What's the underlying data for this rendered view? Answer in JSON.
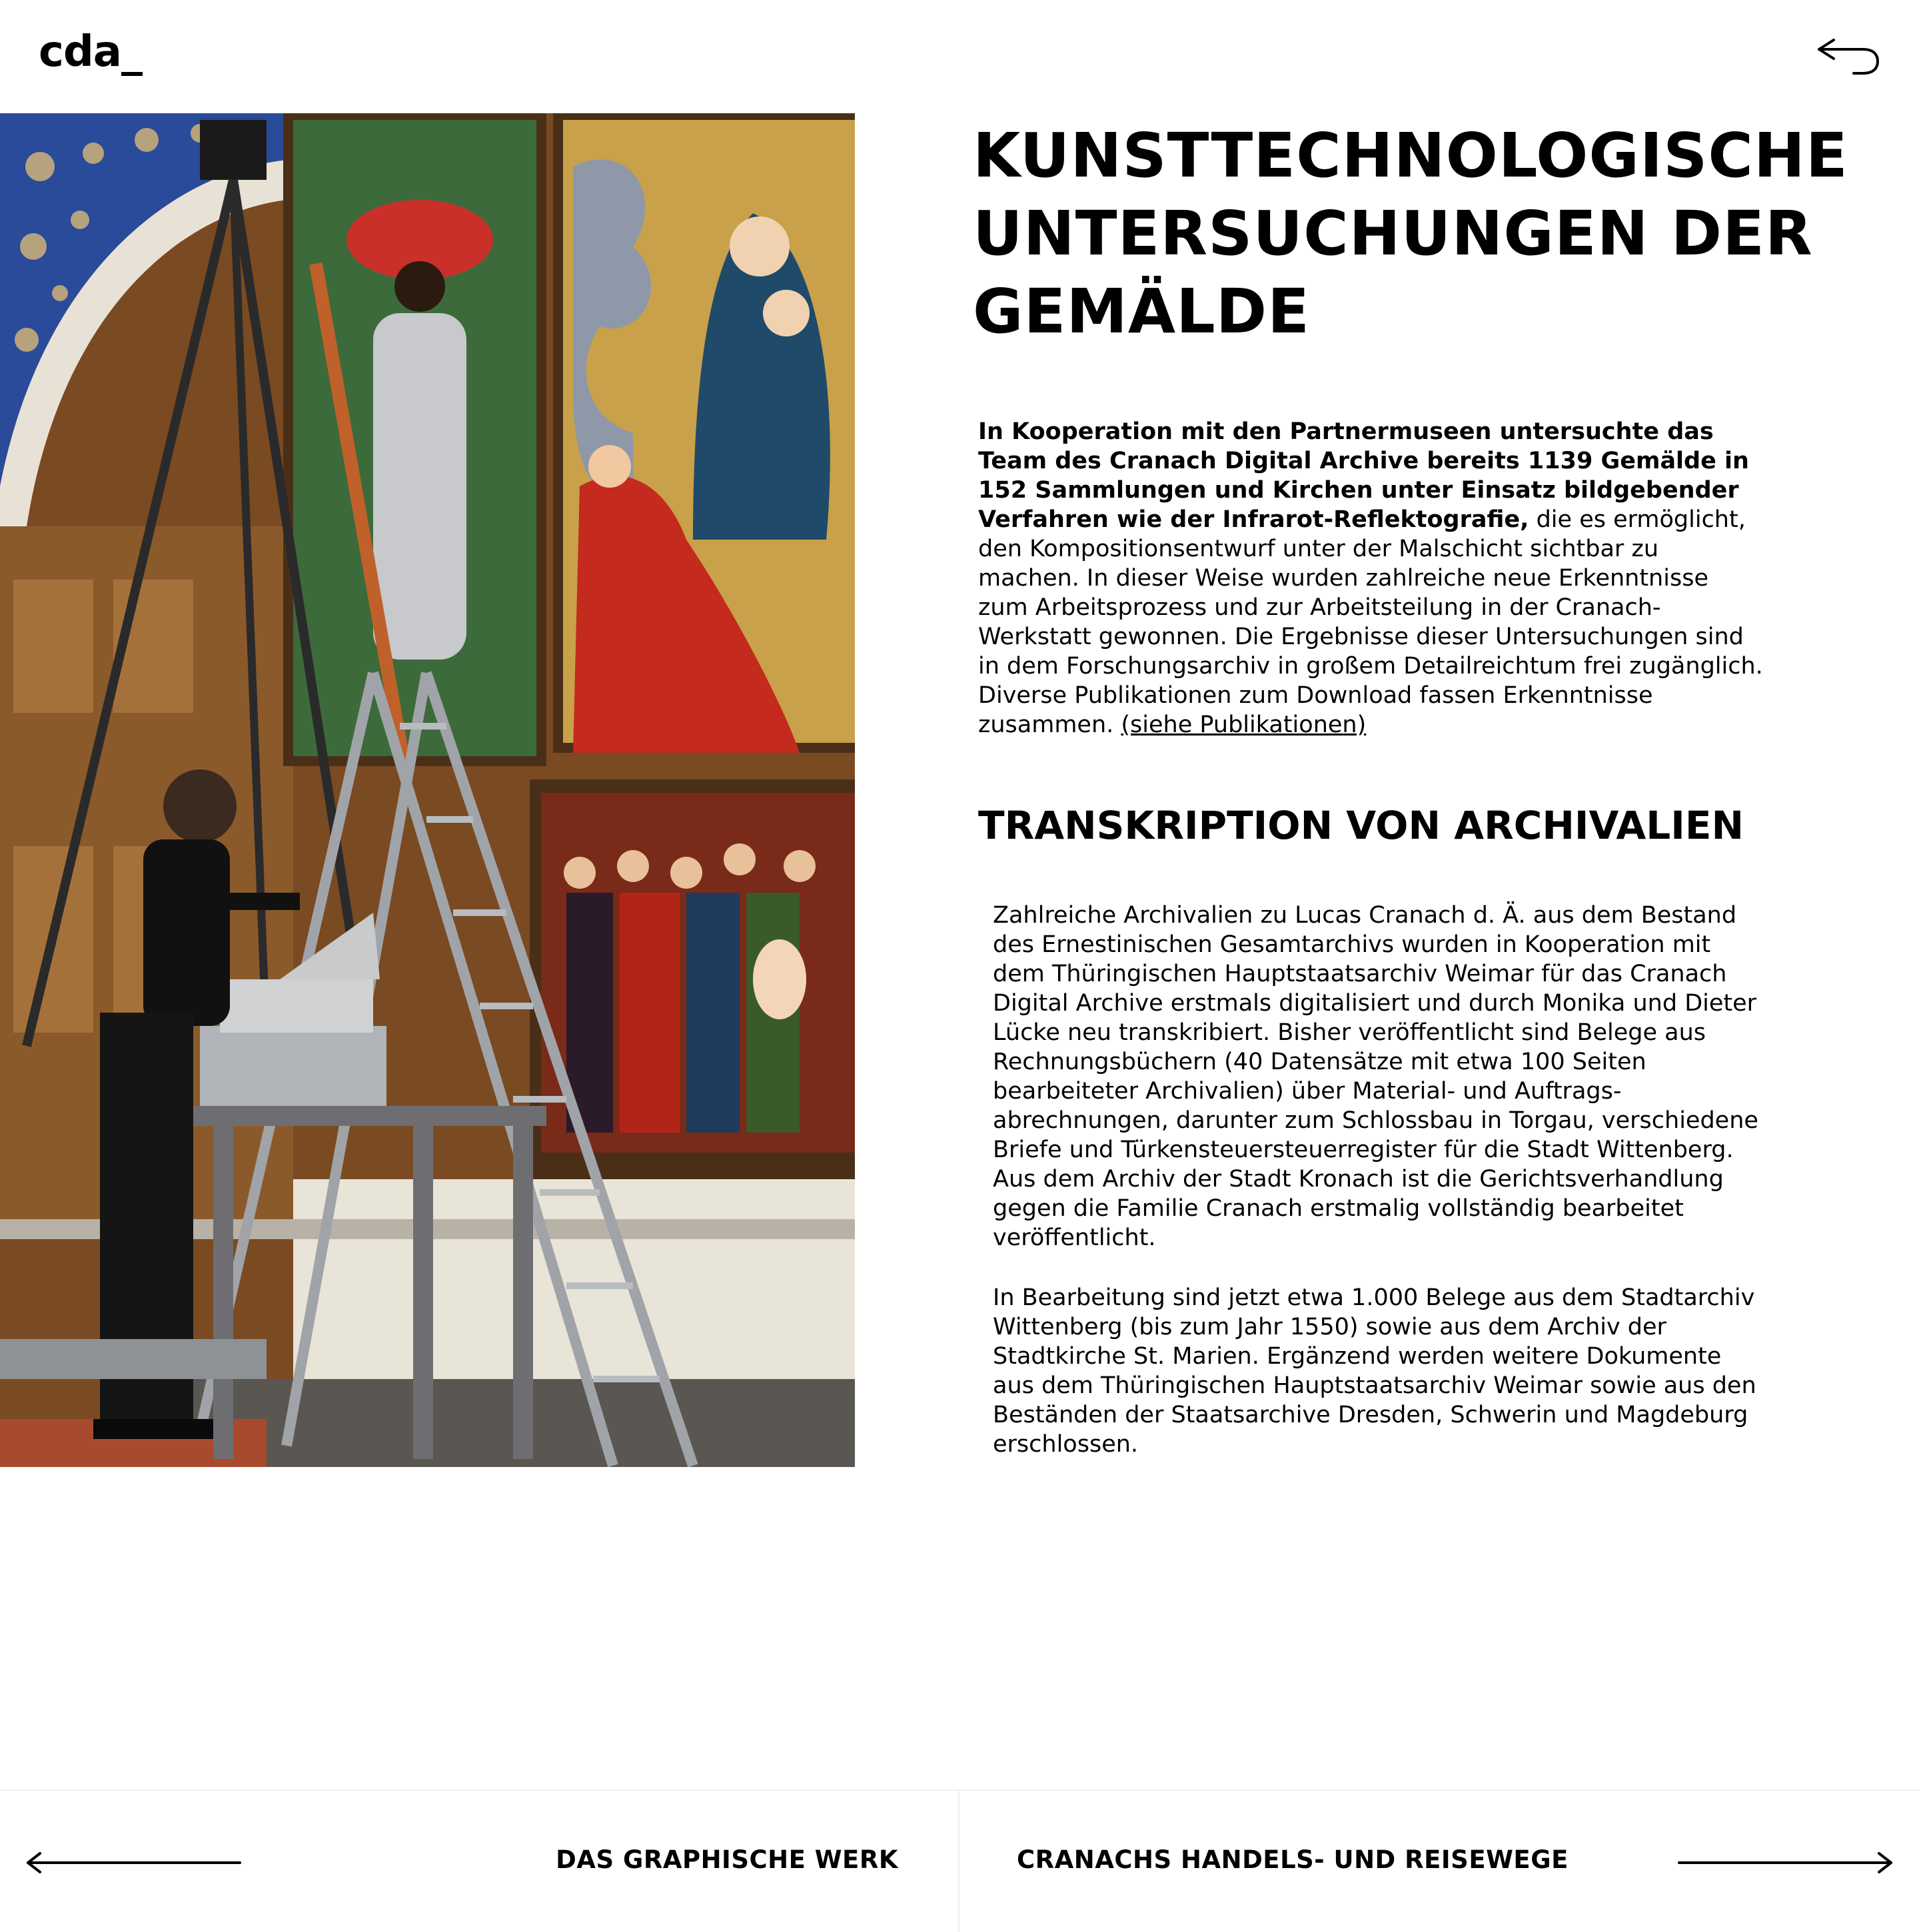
{
  "header": {
    "logo": "cda_",
    "back_icon": "return-arrow-icon"
  },
  "image": {
    "alt": "Kunsttechnologische Untersuchung vor dem Altar"
  },
  "section1": {
    "title": "KUNSTTECHNOLOGISCHE UNTERSUCHUNGEN DER GEMÄLDE",
    "text_bold": "In Kooperation mit den Partnermuseen untersuchte das Team des Cranach Digital Archive bereits 1139 Gemälde in 152 Sammlungen und Kirchen unter Einsatz bildgebender Verfahren wie der Infrarot-Reflektografie,",
    "text_regular": " die es ermöglicht, den Kompositionsentwurf unter der Malschicht sichtbar zu machen. In dieser Weise wurden zahlreiche neue Erkenntnisse zum Arbeitsprozess und zur Arbeitsteilung in der Cranach-Werkstatt gewonnen. Die Ergebnisse dieser Untersuchungen sind in dem Forschungsarchiv in großem Detailreichtum frei zugänglich. Diverse Publikationen zum Download fassen Erkenntnisse zusammen. ",
    "link_label": "(siehe Publikationen)"
  },
  "section2": {
    "title": "TRANSKRIPTION VON ARCHIVALIEN",
    "paragraph1": "Zahlreiche Archivalien zu Lucas Cranach d. Ä. aus dem Bestand des Ernestinischen Gesamtarchivs wurden in Kooperation mit dem Thüringischen Hauptstaatsarchiv Weimar für das Cranach Digital Archive erstmals digitalisiert und durch Monika und Dieter Lücke neu transkribiert. Bisher veröffentlicht sind Belege aus Rechnungsbüchern (40 Datensätze mit etwa 100 Seiten bearbeiteter Archivalien) über Material- und Auftrags-abrechnungen, darunter zum Schlossbau in Torgau, verschiedene Briefe und Türkensteuersteuerregister für die Stadt Wittenberg. Aus dem Archiv der Stadt Kronach ist die Gerichtsverhandlung gegen die Familie Cranach erstmalig vollständig bearbeitet veröffentlicht.",
    "paragraph2": "In Bearbeitung sind jetzt etwa 1.000 Belege aus dem Stadtarchiv Wittenberg (bis zum Jahr 1550) sowie aus dem Archiv der Stadtkirche St. Marien. Ergänzend werden weitere Dokumente aus dem Thüringischen Hauptstaatsarchiv Weimar sowie aus den Beständen der Staatsarchive Dresden, Schwerin und Magdeburg erschlossen."
  },
  "footer": {
    "prev_label": "DAS GRAPHISCHE WERK",
    "next_label": "CRANACHS HANDELS- UND REISEWEGE",
    "prev_icon": "arrow-left-icon",
    "next_icon": "arrow-right-icon"
  }
}
